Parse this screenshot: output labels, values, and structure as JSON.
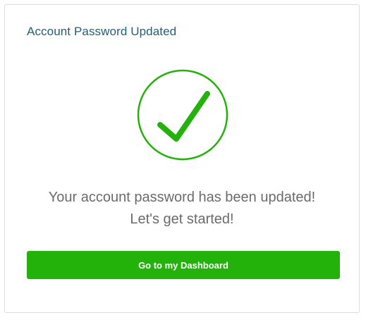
{
  "card": {
    "title": "Account Password Updated",
    "icon": "success-checkmark-icon",
    "message_line1": "Your account password has been updated!",
    "message_line2": "Let's get started!",
    "dashboard_button_label": "Go to my Dashboard"
  },
  "colors": {
    "accent_green": "#22b20a",
    "title_color": "#1f5f78",
    "message_color": "#6b6b6b"
  }
}
